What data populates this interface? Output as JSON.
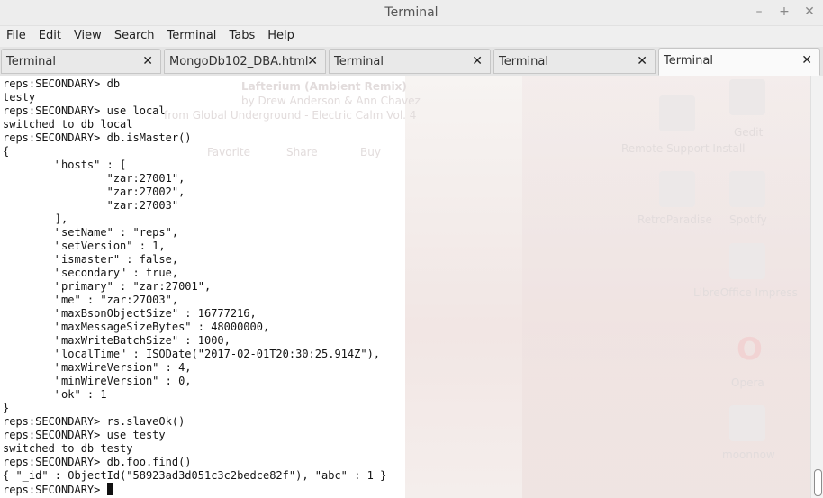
{
  "window": {
    "title": "Terminal"
  },
  "menu": [
    "File",
    "Edit",
    "View",
    "Search",
    "Terminal",
    "Tabs",
    "Help"
  ],
  "tabs": [
    {
      "label": "Terminal",
      "active": false
    },
    {
      "label": "MongoDb102_DBA.html",
      "active": false
    },
    {
      "label": "Terminal",
      "active": false
    },
    {
      "label": "Terminal",
      "active": false
    },
    {
      "label": "Terminal",
      "active": true
    }
  ],
  "terminal": {
    "lines": [
      "reps:SECONDARY> db",
      "testy",
      "reps:SECONDARY> use local",
      "switched to db local",
      "reps:SECONDARY> db.isMaster()",
      "{",
      "        \"hosts\" : [",
      "                \"zar:27001\",",
      "                \"zar:27002\",",
      "                \"zar:27003\"",
      "        ],",
      "        \"setName\" : \"reps\",",
      "        \"setVersion\" : 1,",
      "        \"ismaster\" : false,",
      "        \"secondary\" : true,",
      "        \"primary\" : \"zar:27001\",",
      "        \"me\" : \"zar:27003\",",
      "        \"maxBsonObjectSize\" : 16777216,",
      "        \"maxMessageSizeBytes\" : 48000000,",
      "        \"maxWriteBatchSize\" : 1000,",
      "        \"localTime\" : ISODate(\"2017-02-01T20:30:25.914Z\"),",
      "        \"maxWireVersion\" : 4,",
      "        \"minWireVersion\" : 0,",
      "        \"ok\" : 1",
      "}",
      "reps:SECONDARY> rs.slaveOk()",
      "reps:SECONDARY> use testy",
      "switched to db testy",
      "reps:SECONDARY> db.foo.find()",
      "{ \"_id\" : ObjectId(\"58923ad3d051c3c2bedce82f\"), \"abc\" : 1 }"
    ],
    "prompt": "reps:SECONDARY> "
  },
  "background_ghost": {
    "track_title": "Lafterium (Ambient Remix)",
    "track_artist": "by Drew Anderson & Ann Chavez",
    "track_album": "from Global Underground - Electric Calm Vol. 4",
    "buttons": [
      "Favorite",
      "Share",
      "Buy"
    ],
    "desktop_icons": [
      "Gedit",
      "Remote Support Install",
      "RetroParadise",
      "Spotify",
      "LibreOffice Impress",
      "Opera",
      "moonnow"
    ]
  }
}
